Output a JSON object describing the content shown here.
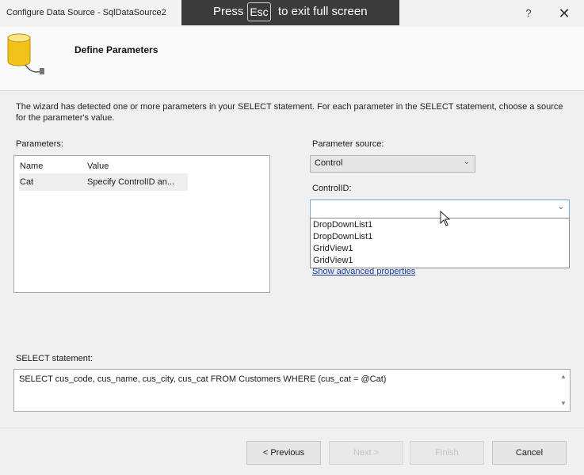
{
  "window": {
    "title": "Configure Data Source - SqlDataSource2",
    "help_label": "?",
    "close_label": "✕"
  },
  "fullscreen_banner": {
    "press": "Press",
    "key": "Esc",
    "rest": "to exit full screen"
  },
  "header": {
    "title": "Define Parameters",
    "icon": "database-icon"
  },
  "intro_text": "The wizard has detected one or more parameters in your SELECT statement. For each parameter in the SELECT statement, choose a source for the parameter's value.",
  "parameters": {
    "label": "Parameters:",
    "columns": [
      "Name",
      "Value"
    ],
    "rows": [
      {
        "name": "Cat",
        "value": "Specify ControlID an..."
      }
    ]
  },
  "parameter_source": {
    "label": "Parameter source:",
    "value": "Control"
  },
  "control_id": {
    "label": "ControlID:",
    "value": "",
    "options": [
      "DropDownList1",
      "DropDownList1",
      "GridView1",
      "GridView1"
    ]
  },
  "advanced_link": "Show advanced properties",
  "select_statement": {
    "label": "SELECT statement:",
    "text": "SELECT cus_code, cus_name, cus_city, cus_cat FROM Customers WHERE (cus_cat = @Cat)"
  },
  "buttons": {
    "previous": "< Previous",
    "next": "Next >",
    "finish": "Finish",
    "cancel": "Cancel"
  },
  "colors": {
    "accent_border": "#7aa7d6",
    "link": "#1a3c9c",
    "icon_yellow": "#f2c21a"
  }
}
